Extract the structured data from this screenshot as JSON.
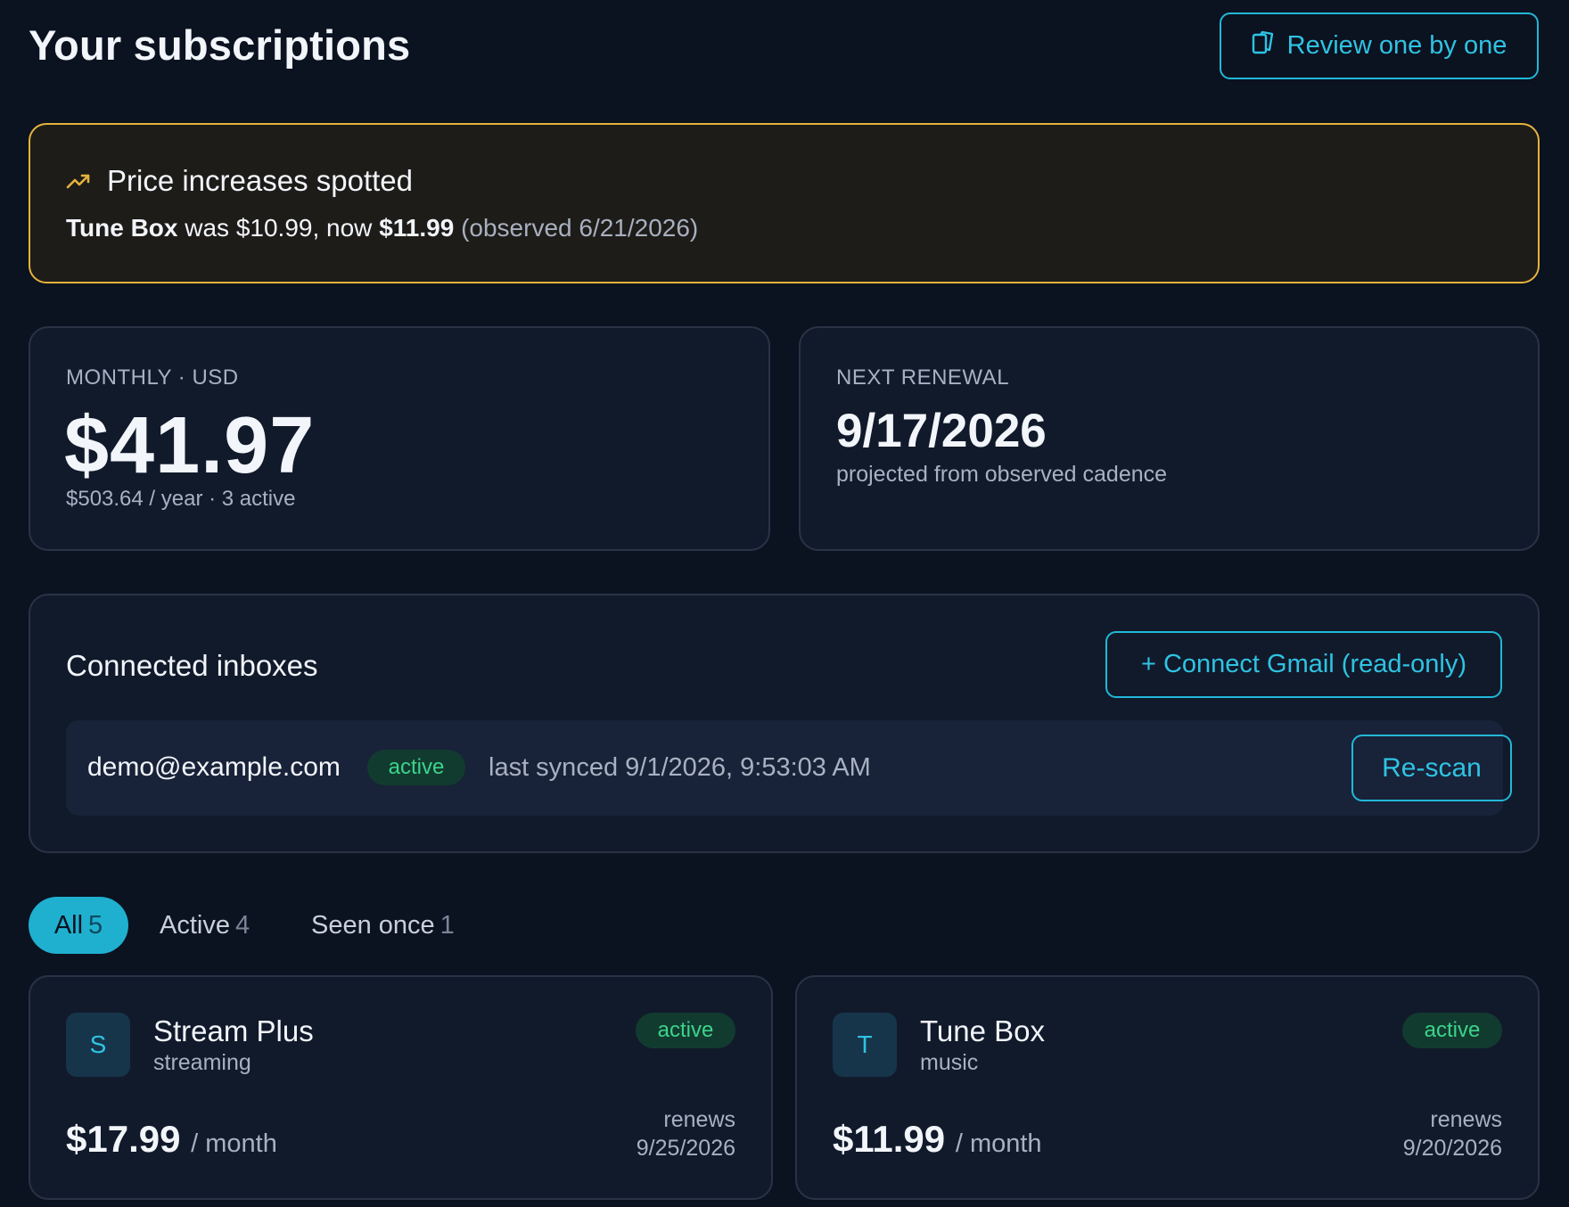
{
  "header": {
    "title": "Your subscriptions",
    "review_button": "Review one by one"
  },
  "price_alert": {
    "title": "Price increases spotted",
    "service": "Tune Box",
    "was_text": "was $10.99, now",
    "new_price": "$11.99",
    "observed": "(observed 6/21/2026)"
  },
  "stats": {
    "monthly": {
      "label": "MONTHLY · USD",
      "value": "$41.97",
      "sub": "$503.64 / year · 3 active"
    },
    "renewal": {
      "label": "NEXT RENEWAL",
      "value": "9/17/2026",
      "sub": "projected from observed cadence"
    }
  },
  "inboxes": {
    "title": "Connected inboxes",
    "connect_button": "+ Connect Gmail (read-only)",
    "items": [
      {
        "email": "demo@example.com",
        "status": "active",
        "synced": "last synced 9/1/2026, 9:53:03 AM",
        "rescan_button": "Re-scan"
      }
    ]
  },
  "tabs": [
    {
      "label": "All",
      "count": "5",
      "selected": true
    },
    {
      "label": "Active",
      "count": "4",
      "selected": false
    },
    {
      "label": "Seen once",
      "count": "1",
      "selected": false
    }
  ],
  "subscriptions": [
    {
      "initial": "S",
      "name": "Stream Plus",
      "category": "streaming",
      "status": "active",
      "price": "$17.99",
      "period": "/ month",
      "renews_label": "renews",
      "renews_date": "9/25/2026"
    },
    {
      "initial": "T",
      "name": "Tune Box",
      "category": "music",
      "status": "active",
      "price": "$11.99",
      "period": "/ month",
      "renews_label": "renews",
      "renews_date": "9/20/2026"
    }
  ],
  "colors": {
    "background": "#0b1220",
    "accent": "#22b8d8",
    "alert_border": "#e5b33c",
    "active_badge": "#3bd48b"
  },
  "icons": {
    "review": "cards-icon",
    "trend": "trending-up-icon"
  }
}
